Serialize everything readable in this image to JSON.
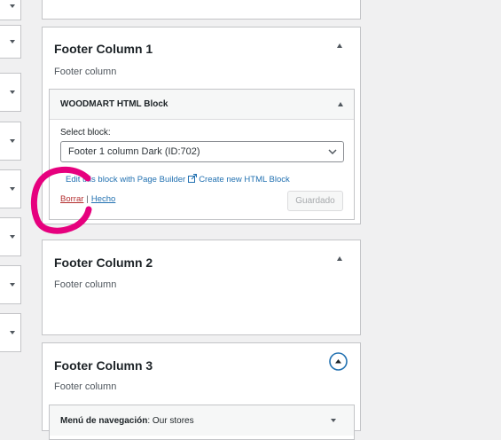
{
  "colors": {
    "page_bg": "#f0f0f1",
    "link": "#2271b1",
    "delete_link": "#b32d2e",
    "annotation_circle": "#e6007e",
    "focus_ring": "#2271b1"
  },
  "panels": [
    {
      "title": "Footer Column 1",
      "description": "Footer column",
      "expanded": true,
      "widget": {
        "title": "WOODMART HTML Block",
        "select_label": "Select block:",
        "selected_value": "Footer 1 column Dark (ID:702)",
        "edit_link": "Edit this block with Page Builder",
        "create_link": "Create new HTML Block",
        "delete_label": "Borrar",
        "separator": "|",
        "done_label": "Hecho",
        "save_label": "Guardado"
      }
    },
    {
      "title": "Footer Column 2",
      "description": "Footer column",
      "expanded": false
    },
    {
      "title": "Footer Column 3",
      "description": "Footer column",
      "expanded": false,
      "widget": {
        "title": "Menú de navegación",
        "title_suffix": ": Our stores"
      }
    }
  ],
  "icons": {
    "panel_toggle": "caret-up-icon",
    "panel_toggle_focused": "circled-caret-up-icon",
    "widget_toggle": "caret-down-icon",
    "select_arrow": "chevron-down-icon",
    "external_link": "external-link-icon",
    "sidebar_toggle": "caret-down-icon"
  }
}
